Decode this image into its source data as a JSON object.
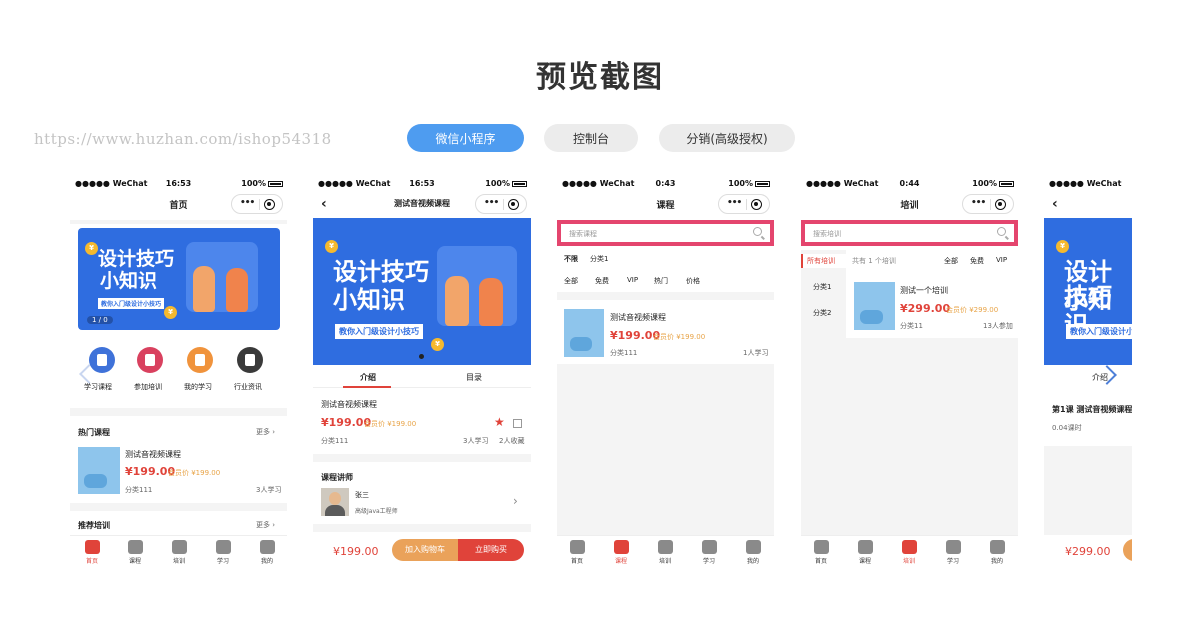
{
  "page": {
    "title": "预览截图",
    "watermark": "https://www.huzhan.com/ishop54318",
    "tabs": [
      {
        "label": "微信小程序",
        "active": true
      },
      {
        "label": "控制台",
        "active": false
      },
      {
        "label": "分销(高级授权)",
        "active": false
      }
    ]
  },
  "statusbar": {
    "carrier": "●●●●● WeChat",
    "battery": "100%"
  },
  "screen1": {
    "time": "16:53",
    "nav_title": "首页",
    "banner": {
      "line1": "设计技巧",
      "line2": "小知识",
      "subtitle": "教你入门级设计小技巧",
      "counter": "1 / 0",
      "coin": "¥"
    },
    "menu": [
      {
        "label": "学习课程",
        "color": "#3f72d9",
        "icon": "book-icon"
      },
      {
        "label": "参加培训",
        "color": "#d9415f",
        "icon": "bookmark-icon"
      },
      {
        "label": "我的学习",
        "color": "#f0933c",
        "icon": "doc-icon"
      },
      {
        "label": "行业资讯",
        "color": "#3a3a3a",
        "icon": "news-icon"
      }
    ],
    "hot_title": "热门课程",
    "more": "更多",
    "course": {
      "name": "测试音视频课程",
      "price": "¥199.00",
      "vip": "会员价 ¥199.00",
      "category": "分类111",
      "learners": "3人学习"
    },
    "rec_title": "推荐培训"
  },
  "tabbar": [
    "首页",
    "课程",
    "培训",
    "学习",
    "我的"
  ],
  "screen2": {
    "time": "16:53",
    "nav_title": "测试音视频课程",
    "tab_intro": "介绍",
    "tab_catalog": "目录",
    "course_name": "测试音视频课程",
    "price": "¥199.00",
    "vip": "会员价 ¥199.00",
    "category": "分类111",
    "learners": "3人学习",
    "favorites": "2人收藏",
    "teacher_title": "课程讲师",
    "teacher_name": "张三",
    "teacher_role": "高级Java工程师",
    "bottom_price": "¥199.00",
    "add_cart": "加入购物车",
    "buy_now": "立即购买"
  },
  "screen3": {
    "time": "0:43",
    "nav_title": "课程",
    "search_placeholder": "搜索课程",
    "filter_row1": [
      "不限",
      "分类1"
    ],
    "filter_row2": [
      "全部",
      "免费",
      "VIP",
      "热门",
      "价格"
    ],
    "course": {
      "name": "测试音视频课程",
      "price": "¥199.00",
      "vip": "会员价 ¥199.00",
      "category": "分类111",
      "learners": "1人学习"
    }
  },
  "screen4": {
    "time": "0:44",
    "nav_title": "培训",
    "search_placeholder": "搜索培训",
    "side": [
      "所有培训",
      "分类1",
      "分类2"
    ],
    "count": "共有 1 个培训",
    "filters": [
      "全部",
      "免费",
      "VIP"
    ],
    "item": {
      "name": "测试一个培训",
      "price": "¥299.00",
      "vip": "会员价 ¥299.00",
      "category": "分类11",
      "joined": "13人参加"
    }
  },
  "screen5": {
    "tab_intro": "介绍",
    "lesson": "第1课 测试音视频课程",
    "hours": "0.04课时",
    "price": "¥299.00"
  }
}
